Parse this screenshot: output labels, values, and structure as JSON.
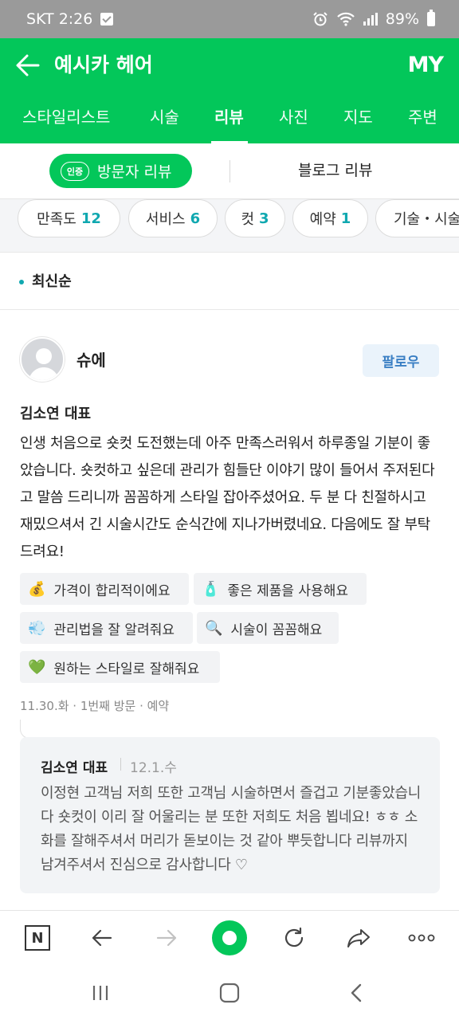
{
  "status_bar": {
    "time": "SKT 2:26",
    "battery": "89%"
  },
  "header": {
    "title": "예시카 헤어",
    "my_label": "MY"
  },
  "tabs": [
    {
      "label": "스타일리스트",
      "active": false
    },
    {
      "label": "시술",
      "active": false
    },
    {
      "label": "리뷰",
      "active": true
    },
    {
      "label": "사진",
      "active": false
    },
    {
      "label": "지도",
      "active": false
    },
    {
      "label": "주변",
      "active": false
    }
  ],
  "review_toggle": {
    "cert_badge": "인증",
    "visitor_label": "방문자 리뷰",
    "blog_label": "블로그 리뷰"
  },
  "filters": [
    {
      "label": "만족도",
      "count": "12"
    },
    {
      "label": "서비스",
      "count": "6"
    },
    {
      "label": "컷",
      "count": "3"
    },
    {
      "label": "예약",
      "count": "1"
    },
    {
      "label": "기술・시술",
      "count": ""
    }
  ],
  "sort": {
    "label": "최신순"
  },
  "review": {
    "user_name": "슈에",
    "follow_label": "팔로우",
    "designer": "김소연 대표",
    "body": "인생 처음으로 숏컷 도전했는데 아주 만족스러워서 하루종일 기분이 좋았습니다. 숏컷하고 싶은데 관리가 힘들단 이야기 많이 들어서 주저된다고 말씀 드리니까 꼼꼼하게 스타일 잡아주셨어요. 두 분 다 친절하시고 재밌으셔서 긴 시술시간도 순식간에 지나가버렸네요. 다음에도 잘 부탁드려요!",
    "tags": [
      {
        "icon": "💰",
        "icon_name": "money-icon",
        "label": "가격이 합리적이에요"
      },
      {
        "icon": "🧴",
        "icon_name": "product-bottle-icon",
        "label": "좋은 제품을 사용해요"
      },
      {
        "icon": "💨",
        "icon_name": "hair-dryer-icon",
        "label": "관리법을 잘 알려줘요"
      },
      {
        "icon": "🔍",
        "icon_name": "magnifier-icon",
        "label": "시술이 꼼꼼해요"
      },
      {
        "icon": "💚",
        "icon_name": "green-heart-icon",
        "label": "원하는 스타일로 잘해줘요"
      }
    ],
    "meta": "11.30.화 · 1번째 방문 · 예약",
    "reply": {
      "author": "김소연 대표",
      "date": "12.1.수",
      "body": "이정현 고객님 저희 또한 고객님 시술하면서 즐겁고 기분좋았습니다 숏컷이 이리 잘 어울리는 분 또한 저희도 처음 뵙네요! ㅎㅎ 소화를 잘해주셔서 머리가 돋보이는 것 같아 뿌듯합니다 리뷰까지 남겨주셔서 진심으로 감사합니다 ♡"
    }
  },
  "browser_bar": {
    "naver_label": "N"
  },
  "colors": {
    "brand_green": "#03c75a",
    "count_teal": "#10a8b0",
    "follow_blue": "#3a7fc4"
  }
}
